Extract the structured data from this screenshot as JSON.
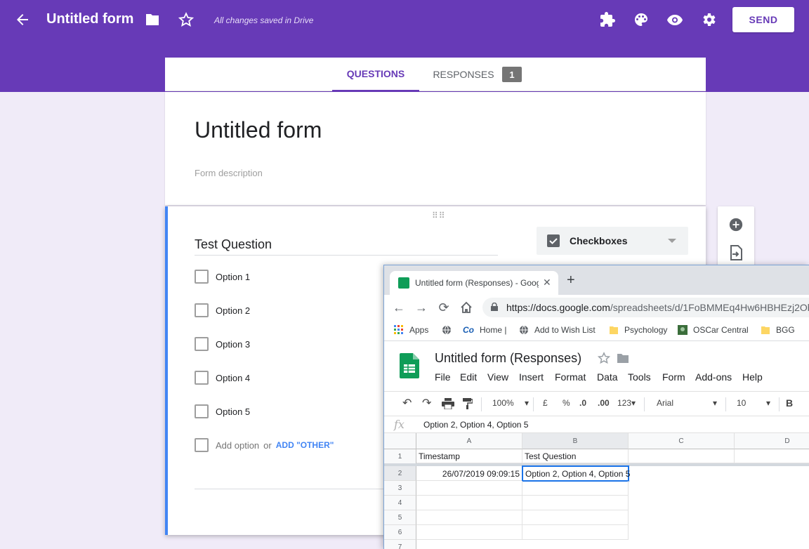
{
  "header": {
    "title": "Untitled form",
    "saved_status": "All changes saved in Drive",
    "send_label": "SEND"
  },
  "tabs": {
    "questions": "QUESTIONS",
    "responses": "RESPONSES",
    "responses_count": "1"
  },
  "form": {
    "title": "Untitled form",
    "description_placeholder": "Form description"
  },
  "question": {
    "title": "Test Question",
    "type": "Checkboxes",
    "options": [
      "Option 1",
      "Option 2",
      "Option 3",
      "Option 4",
      "Option 5"
    ],
    "add_option": "Add option",
    "or": "or",
    "add_other": "ADD \"OTHER\""
  },
  "browser": {
    "tab_title": "Untitled form (Responses) - Goog",
    "url_host": "https://docs.google.com",
    "url_path": "/spreadsheets/d/1FoBMMEq4Hw6HBHEzj2Ob",
    "bookmarks": [
      "Apps",
      "Home |",
      "Add to Wish List",
      "Psychology",
      "OSCar Central",
      "BGG"
    ]
  },
  "sheet": {
    "title": "Untitled form (Responses)",
    "menu": [
      "File",
      "Edit",
      "View",
      "Insert",
      "Format",
      "Data",
      "Tools",
      "Form",
      "Add-ons",
      "Help"
    ],
    "toolbar": {
      "zoom": "100%",
      "currency": "£",
      "percent": "%",
      "dec_less": ".0",
      "dec_more": ".00",
      "format": "123",
      "font": "Arial",
      "font_size": "10",
      "bold": "B"
    },
    "fx_label": "fx",
    "formula": "Option 2, Option 4, Option 5",
    "columns": [
      "A",
      "B",
      "C",
      "D"
    ],
    "rows": [
      "1",
      "2",
      "3",
      "4",
      "5",
      "6",
      "7"
    ],
    "cells": {
      "a1": "Timestamp",
      "b1": "Test Question",
      "a2": "26/07/2019 09:09:15",
      "b2": "Option 2, Option 4, Option 5"
    }
  },
  "colors": {
    "brand": "#673ab7",
    "background": "#f0ebf8",
    "accent_blue": "#4285f4",
    "sheets_green": "#0f9d58"
  }
}
